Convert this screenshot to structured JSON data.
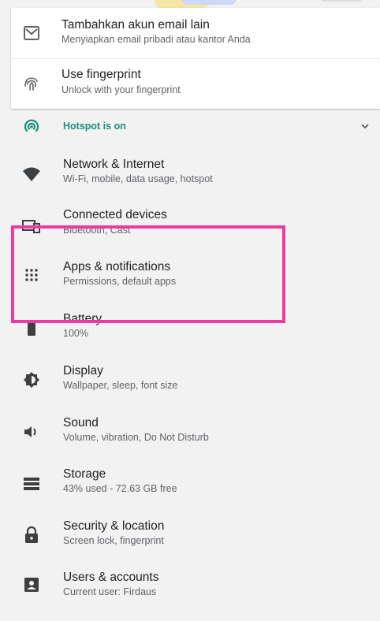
{
  "suggestions": [
    {
      "title": "Tambahkan akun email lain",
      "subtitle": "Menyiapkan email pribadi atau kantor Anda",
      "icon": "email-icon"
    },
    {
      "title": "Use fingerprint",
      "subtitle": "Unlock with your fingerprint",
      "icon": "fingerprint-icon"
    }
  ],
  "hotspot": {
    "label": "Hotspot is on",
    "icon": "hotspot-icon"
  },
  "settings": [
    {
      "title": "Network & Internet",
      "subtitle": "Wi-Fi, mobile, data usage, hotspot",
      "icon": "wifi-icon"
    },
    {
      "title": "Connected devices",
      "subtitle": "Bluetooth, Cast",
      "icon": "devices-icon"
    },
    {
      "title": "Apps & notifications",
      "subtitle": "Permissions, default apps",
      "icon": "apps-icon"
    },
    {
      "title": "Battery",
      "subtitle": "100%",
      "icon": "battery-icon"
    },
    {
      "title": "Display",
      "subtitle": "Wallpaper, sleep, font size",
      "icon": "display-icon"
    },
    {
      "title": "Sound",
      "subtitle": "Volume, vibration, Do Not Disturb",
      "icon": "sound-icon"
    },
    {
      "title": "Storage",
      "subtitle": "43% used - 72.63 GB free",
      "icon": "storage-icon"
    },
    {
      "title": "Security & location",
      "subtitle": "Screen lock, fingerprint",
      "icon": "lock-icon"
    },
    {
      "title": "Users & accounts",
      "subtitle": "Current user: Firdaus",
      "icon": "account-icon"
    }
  ],
  "colors": {
    "accent": "#1a8f7a",
    "highlight": "#ee3aa0",
    "icon": "#5f6368"
  }
}
